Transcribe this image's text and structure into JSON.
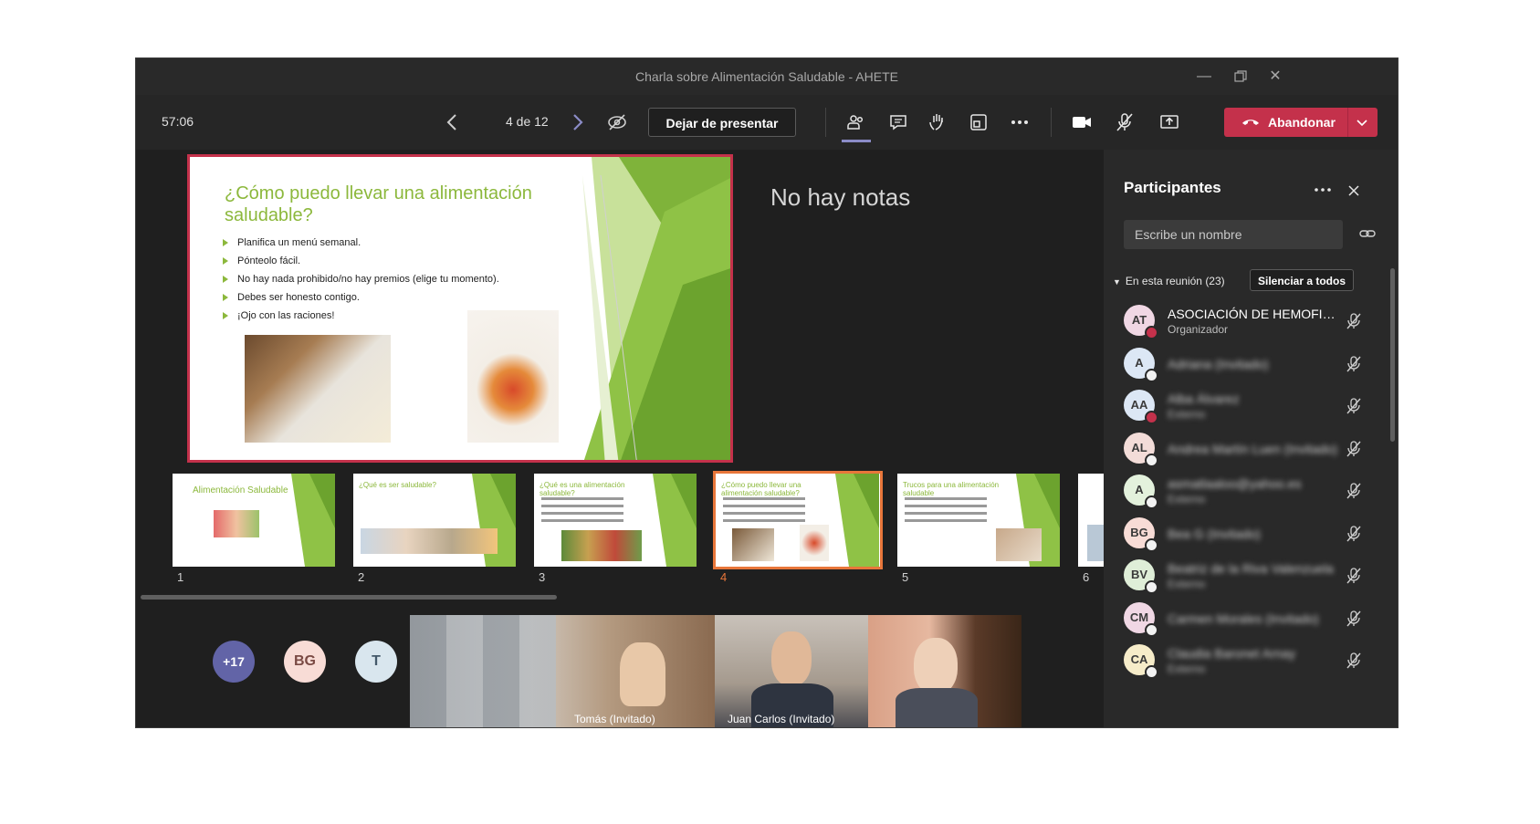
{
  "window": {
    "title": "Charla sobre Alimentación Saludable - AHETE"
  },
  "toolbar": {
    "timer": "57:06",
    "page_counter": "4 de 12",
    "stop_presenting_label": "Dejar de presentar",
    "leave_label": "Abandonar"
  },
  "slide": {
    "title": "¿Cómo puedo llevar una alimentación saludable?",
    "bullets": [
      "Planifica un menú semanal.",
      "Pónteolo fácil.",
      "No hay nada prohibido/no hay premios (elige tu momento).",
      "Debes ser honesto contigo.",
      "¡Ojo con las raciones!"
    ]
  },
  "notes": "No hay notas",
  "thumbnails": [
    {
      "number": "1",
      "title": "Alimentación Saludable"
    },
    {
      "number": "2",
      "title": "¿Qué es ser saludable?"
    },
    {
      "number": "3",
      "title": "¿Qué es una alimentación saludable?"
    },
    {
      "number": "4",
      "title": "¿Cómo puedo llevar una alimentación saludable?"
    },
    {
      "number": "5",
      "title": "Trucos para una alimentación saludable"
    },
    {
      "number": "6",
      "title": ""
    }
  ],
  "video_strip": {
    "overflow_count": "+17",
    "avatar_bg": "BG",
    "avatar_t": "T",
    "videos": [
      {
        "label": "Tomás (Invitado)"
      },
      {
        "label": "Juan Carlos (Invitado)"
      }
    ]
  },
  "participants_panel": {
    "title": "Participantes",
    "search_placeholder": "Escribe un nombre",
    "section_label": "En esta reunión (23)",
    "mute_all_label": "Silenciar a todos",
    "participants": [
      {
        "initials": "AT",
        "name": "ASOCIACIÓN DE HEMOFILIA ...",
        "role": "Organizador",
        "avatar_color": "#f0d7e4",
        "status_color": "#c4314b"
      },
      {
        "initials": "A",
        "name": "Adriana (Invitado)",
        "role": "",
        "avatar_color": "#dce7f5",
        "status_color": "#f2f2f2"
      },
      {
        "initials": "AA",
        "name": "Alba Álvarez",
        "role": "Externo",
        "avatar_color": "#dce7f5",
        "status_color": "#c4314b"
      },
      {
        "initials": "AL",
        "name": "Andrea Martín Luen (Invitado)",
        "role": "",
        "avatar_color": "#f3dcd8",
        "status_color": "#f2f2f2"
      },
      {
        "initials": "A",
        "name": "asmatlaaloo@yahoo.es",
        "role": "Externo",
        "avatar_color": "#e3f1dc",
        "status_color": "#f2f2f2"
      },
      {
        "initials": "BG",
        "name": "Bea G (Invitado)",
        "role": "",
        "avatar_color": "#f8dcd6",
        "status_color": "#f2f2f2"
      },
      {
        "initials": "BV",
        "name": "Beatriz de la Riva Valenzuela",
        "role": "Externo",
        "avatar_color": "#dfeed8",
        "status_color": "#f2f2f2"
      },
      {
        "initials": "CM",
        "name": "Carmen Morales (Invitado)",
        "role": "",
        "avatar_color": "#f0d7e4",
        "status_color": "#f2f2f2"
      },
      {
        "initials": "CA",
        "name": "Claudia Baronet Arnay",
        "role": "Externo",
        "avatar_color": "#f6ecc9",
        "status_color": "#f2f2f2"
      }
    ]
  },
  "colors": {
    "accent_red": "#c4314b",
    "slide_green": "#8cb83c",
    "active_orange": "#e8763a"
  }
}
